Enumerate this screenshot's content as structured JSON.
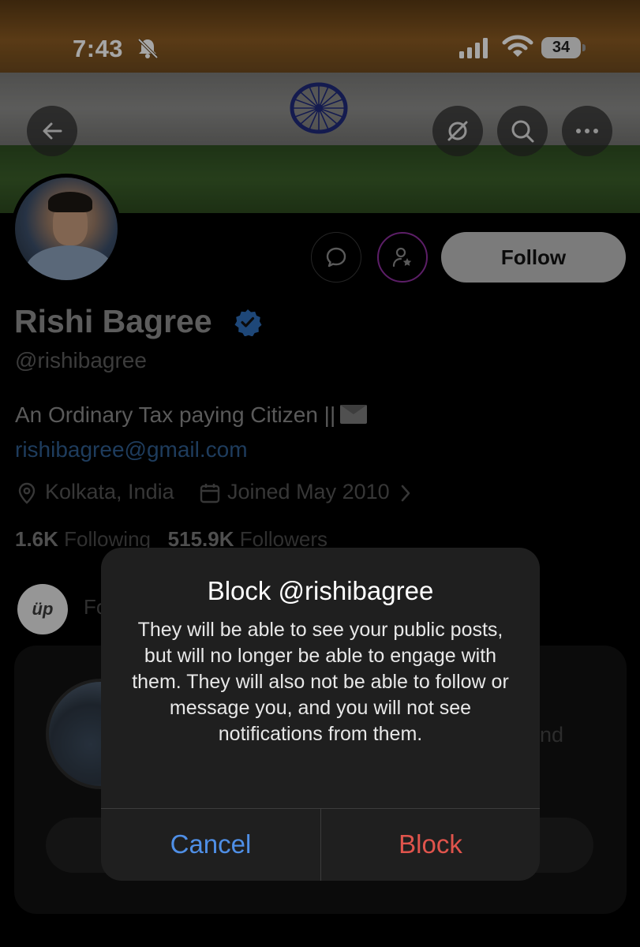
{
  "status_bar": {
    "time": "7:43",
    "battery": "34"
  },
  "profile": {
    "name": "Rishi Bagree",
    "handle": "@rishibagree",
    "bio": "An Ordinary Tax paying Citizen ||",
    "email": "rishibagree@gmail.com",
    "location": "Kolkata, India",
    "joined": "Joined May 2010",
    "following_count": "1.6K",
    "following_label": "Following",
    "followers_count": "515.9K",
    "followers_label": "Followers",
    "follow_button": "Follow"
  },
  "followed_by": {
    "avatar_text": "üp",
    "text_partial": "Fo"
  },
  "card": {
    "text_partial": "nd"
  },
  "dialog": {
    "title": "Block @rishibagree",
    "message": "They will be able to see your public posts, but will no longer be able to engage with them. They will also not be able to follow or message you, and you will not see notifications from them.",
    "cancel_label": "Cancel",
    "block_label": "Block"
  },
  "colors": {
    "cancel": "#4f8fe6",
    "block": "#e0544c",
    "verified": "#2f6eb8",
    "link": "#2f5d8f"
  },
  "icons": [
    "bell-slash-icon",
    "signal-icon",
    "wifi-icon",
    "back-arrow-icon",
    "no-notifications-icon",
    "search-icon",
    "more-icon",
    "message-icon",
    "subscribe-icon",
    "verified-icon",
    "location-pin-icon",
    "calendar-icon",
    "chevron-right-icon"
  ]
}
